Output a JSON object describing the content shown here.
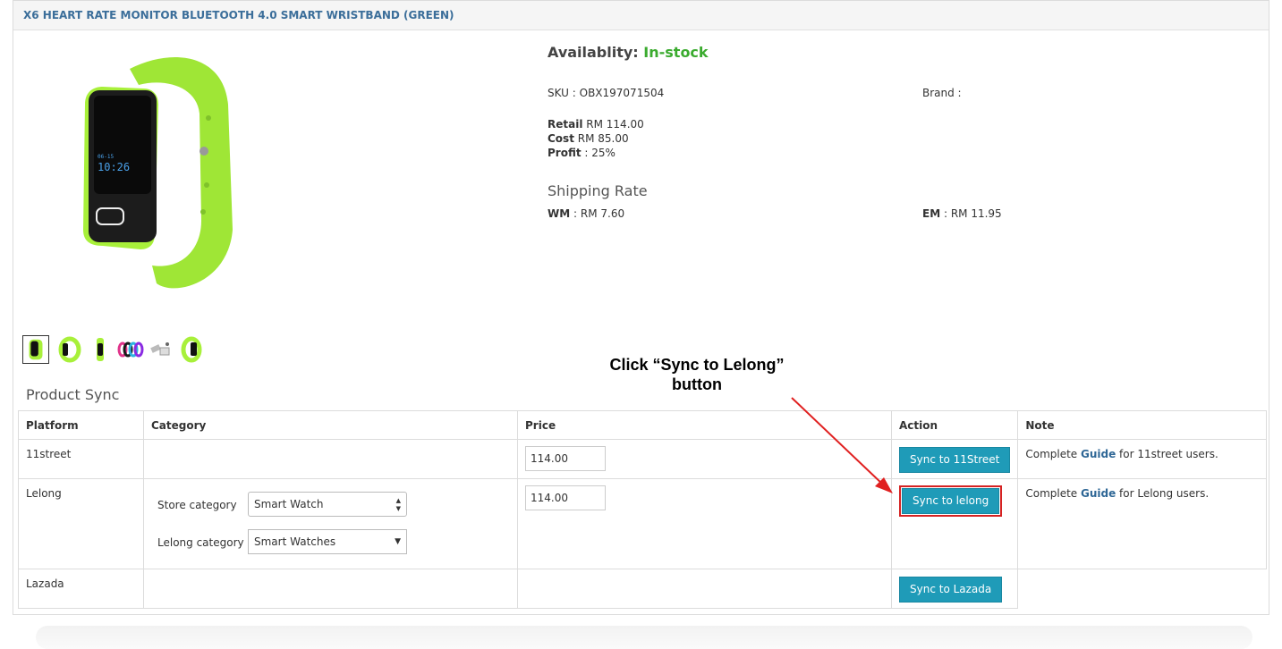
{
  "product": {
    "title": "X6 HEART RATE MONITOR BLUETOOTH 4.0 SMART WRISTBAND (GREEN)",
    "availability_label": "Availablity:",
    "availability_value": "In-stock",
    "sku": "SKU : OBX197071504",
    "brand": "Brand :",
    "retail_label": "Retail",
    "retail_value": "RM 114.00",
    "cost_label": "Cost",
    "cost_value": "RM 85.00",
    "profit_label": "Profit",
    "profit_value": ": 25%",
    "shipping_title": "Shipping Rate",
    "wm_label": "WM",
    "wm_value": ": RM 7.60",
    "em_label": "EM",
    "em_value": ": RM 11.95",
    "watch_time": "10:26",
    "watch_date": "06-15"
  },
  "sync": {
    "title": "Product Sync",
    "headers": [
      "Platform",
      "Category",
      "Price",
      "Action",
      "Note"
    ],
    "rows": [
      {
        "platform": "11street",
        "price": "114.00",
        "action": "Sync to 11Street",
        "note_pre": "Complete ",
        "note_link": "Guide",
        "note_post": " for 11street users."
      },
      {
        "platform": "Lelong",
        "price": "114.00",
        "action": "Sync to lelong",
        "note_pre": "Complete ",
        "note_link": "Guide",
        "note_post": " for Lelong users.",
        "store_category_label": "Store category",
        "store_category_value": "Smart Watch",
        "lelong_category_label": "Lelong category",
        "lelong_category_value": "Smart Watches"
      },
      {
        "platform": "Lazada",
        "action": "Sync to Lazada"
      }
    ]
  },
  "annotation": {
    "line1": "Click “Sync to Lelong”",
    "line2": "button"
  },
  "colors": {
    "title": "#3b6e9a",
    "in_stock": "#3bab2f",
    "button": "#1f9bb8",
    "highlight": "#d52222",
    "band_green": "#a8f03a"
  }
}
